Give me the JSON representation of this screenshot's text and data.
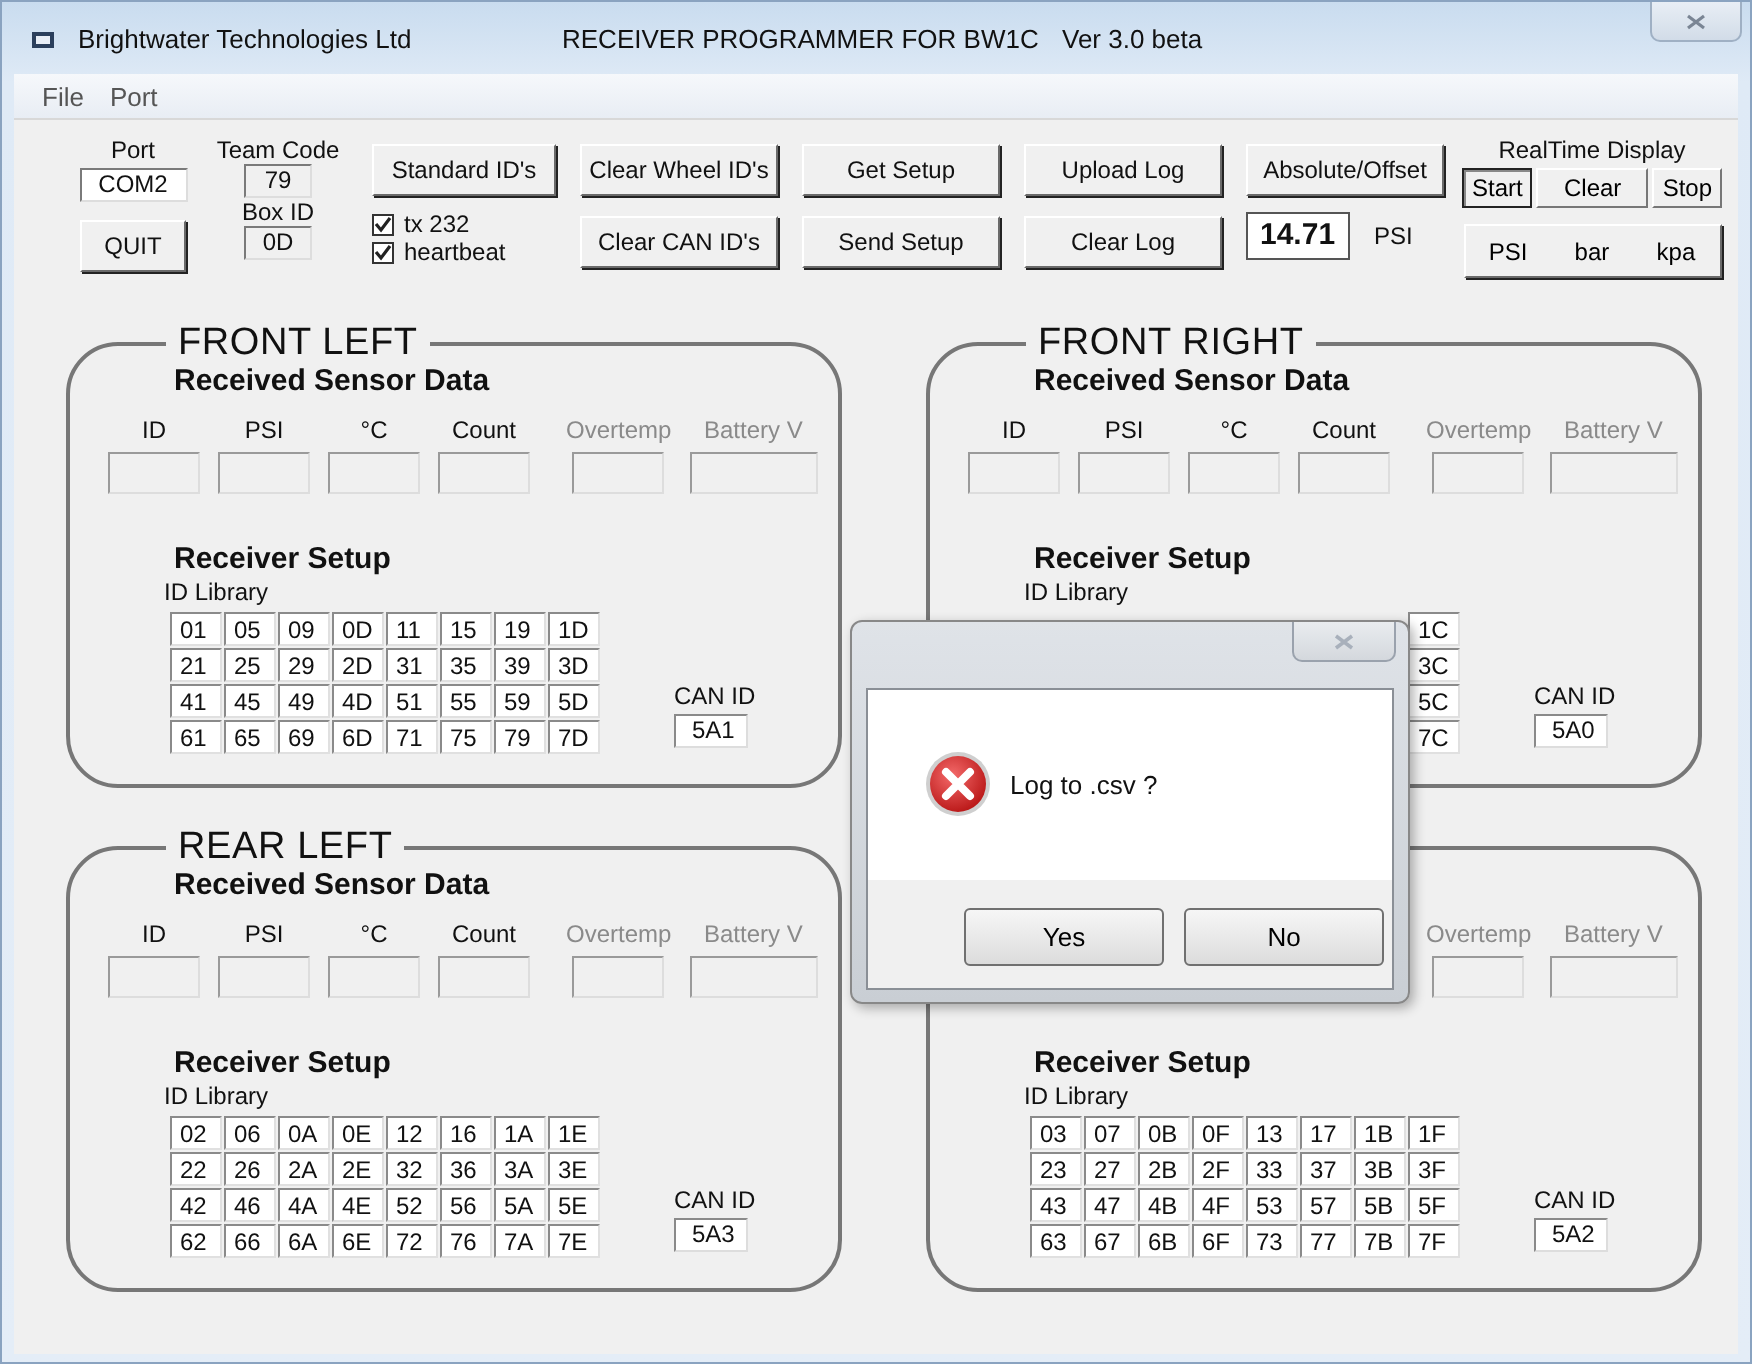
{
  "window": {
    "title_parts": [
      "Brightwater Technologies Ltd",
      "RECEIVER PROGRAMMER FOR BW1C",
      "Ver 3.0 beta"
    ]
  },
  "menu": [
    "File",
    "Port"
  ],
  "toolbar": {
    "port_label": "Port",
    "port_value": "COM2",
    "quit": "QUIT",
    "team_label": "Team Code",
    "team_value": "79",
    "box_label": "Box ID",
    "box_value": "0D",
    "buttons_top": [
      "Standard ID's",
      "Clear Wheel ID's",
      "Get Setup",
      "Upload Log",
      "Absolute/Offset"
    ],
    "checkboxes": [
      {
        "label": "tx 232",
        "checked": true
      },
      {
        "label": "heartbeat",
        "checked": true
      }
    ],
    "buttons_bottom": [
      "Clear CAN ID's",
      "Send Setup",
      "Clear Log"
    ],
    "reading": "14.71",
    "reading_unit": "PSI",
    "realtime_label": "RealTime Display",
    "realtime_buttons": [
      {
        "label": "Start",
        "selected": true
      },
      {
        "label": "Clear",
        "selected": false
      },
      {
        "label": "Stop",
        "selected": false
      }
    ],
    "units": [
      "PSI",
      "bar",
      "kpa"
    ]
  },
  "panels": [
    {
      "title": "FRONT LEFT",
      "sensor_header": "Received Sensor Data",
      "fields": [
        {
          "label": "ID",
          "disabled": false
        },
        {
          "label": "PSI",
          "disabled": false
        },
        {
          "label": "°C",
          "disabled": false
        },
        {
          "label": "Count",
          "disabled": false
        },
        {
          "label": "Overtemp",
          "disabled": true
        },
        {
          "label": "Battery V",
          "disabled": true
        }
      ],
      "setup_header": "Receiver Setup",
      "library_label": "ID Library",
      "ids": [
        [
          "01",
          "05",
          "09",
          "0D",
          "11",
          "15",
          "19",
          "1D"
        ],
        [
          "21",
          "25",
          "29",
          "2D",
          "31",
          "35",
          "39",
          "3D"
        ],
        [
          "41",
          "45",
          "49",
          "4D",
          "51",
          "55",
          "59",
          "5D"
        ],
        [
          "61",
          "65",
          "69",
          "6D",
          "71",
          "75",
          "79",
          "7D"
        ]
      ],
      "can_label": "CAN ID",
      "can_id": "5A1"
    },
    {
      "title": "FRONT RIGHT",
      "sensor_header": "Received Sensor Data",
      "fields": [
        {
          "label": "ID",
          "disabled": false
        },
        {
          "label": "PSI",
          "disabled": false
        },
        {
          "label": "°C",
          "disabled": false
        },
        {
          "label": "Count",
          "disabled": false
        },
        {
          "label": "Overtemp",
          "disabled": true
        },
        {
          "label": "Battery V",
          "disabled": true
        }
      ],
      "setup_header": "Receiver Setup",
      "library_label": "ID Library",
      "ids": [
        [
          "1C"
        ],
        [
          "3C"
        ],
        [
          "5C"
        ],
        [
          "7C"
        ]
      ],
      "can_label": "CAN ID",
      "can_id": "5A0"
    },
    {
      "title": "REAR LEFT",
      "sensor_header": "Received Sensor Data",
      "fields": [
        {
          "label": "ID",
          "disabled": false
        },
        {
          "label": "PSI",
          "disabled": false
        },
        {
          "label": "°C",
          "disabled": false
        },
        {
          "label": "Count",
          "disabled": false
        },
        {
          "label": "Overtemp",
          "disabled": true
        },
        {
          "label": "Battery V",
          "disabled": true
        }
      ],
      "setup_header": "Receiver Setup",
      "library_label": "ID Library",
      "ids": [
        [
          "02",
          "06",
          "0A",
          "0E",
          "12",
          "16",
          "1A",
          "1E"
        ],
        [
          "22",
          "26",
          "2A",
          "2E",
          "32",
          "36",
          "3A",
          "3E"
        ],
        [
          "42",
          "46",
          "4A",
          "4E",
          "52",
          "56",
          "5A",
          "5E"
        ],
        [
          "62",
          "66",
          "6A",
          "6E",
          "72",
          "76",
          "7A",
          "7E"
        ]
      ],
      "can_label": "CAN ID",
      "can_id": "5A3"
    },
    {
      "fields": [
        {
          "label": "Overtemp",
          "disabled": true
        },
        {
          "label": "Battery V",
          "disabled": true
        }
      ],
      "setup_header": "Receiver Setup",
      "library_label": "ID Library",
      "ids": [
        [
          "03",
          "07",
          "0B",
          "0F",
          "13",
          "17",
          "1B",
          "1F"
        ],
        [
          "23",
          "27",
          "2B",
          "2F",
          "33",
          "37",
          "3B",
          "3F"
        ],
        [
          "43",
          "47",
          "4B",
          "4F",
          "53",
          "57",
          "5B",
          "5F"
        ],
        [
          "63",
          "67",
          "6B",
          "6F",
          "73",
          "77",
          "7B",
          "7F"
        ]
      ],
      "can_label": "CAN ID",
      "can_id": "5A2"
    }
  ],
  "dialog": {
    "message": "Log to .csv ?",
    "buttons": [
      "Yes",
      "No"
    ]
  }
}
